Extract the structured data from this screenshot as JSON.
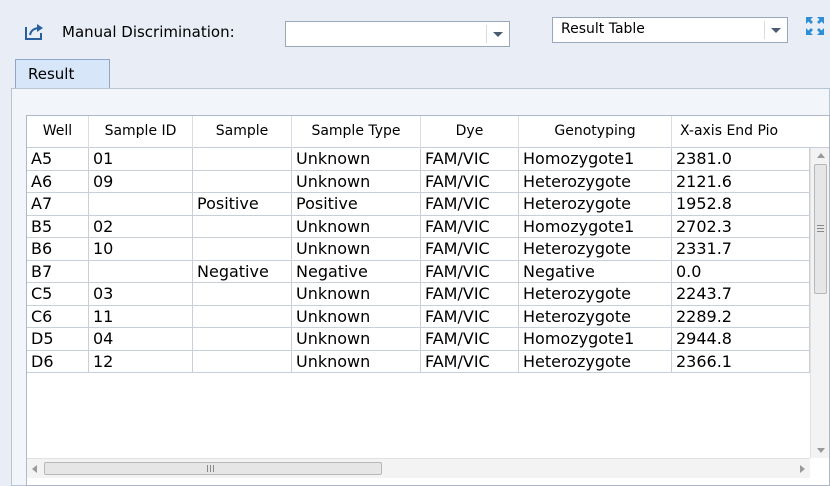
{
  "toolbar": {
    "manual_label": "Manual Discrimination:",
    "manual_value": "",
    "view_value": "Result Table"
  },
  "tabs": [
    {
      "label": "Result"
    }
  ],
  "table": {
    "columns": [
      "Well",
      "Sample ID",
      "Sample",
      "Sample Type",
      "Dye",
      "Genotyping",
      "X-axis End Pio"
    ],
    "rows": [
      [
        "A5",
        "01",
        "",
        "Unknown",
        "FAM/VIC",
        "Homozygote1",
        "2381.0"
      ],
      [
        "A6",
        "09",
        "",
        "Unknown",
        "FAM/VIC",
        "Heterozygote",
        "2121.6"
      ],
      [
        "A7",
        "",
        "Positive",
        "Positive",
        "FAM/VIC",
        "Heterozygote",
        "1952.8"
      ],
      [
        "B5",
        "02",
        "",
        "Unknown",
        "FAM/VIC",
        "Homozygote1",
        "2702.3"
      ],
      [
        "B6",
        "10",
        "",
        "Unknown",
        "FAM/VIC",
        "Heterozygote",
        "2331.7"
      ],
      [
        "B7",
        "",
        "Negative",
        "Negative",
        "FAM/VIC",
        "Negative",
        "0.0"
      ],
      [
        "C5",
        "03",
        "",
        "Unknown",
        "FAM/VIC",
        "Heterozygote",
        "2243.7"
      ],
      [
        "C6",
        "11",
        "",
        "Unknown",
        "FAM/VIC",
        "Heterozygote",
        "2289.2"
      ],
      [
        "D5",
        "04",
        "",
        "Unknown",
        "FAM/VIC",
        "Homozygote1",
        "2944.8"
      ],
      [
        "D6",
        "12",
        "",
        "Unknown",
        "FAM/VIC",
        "Heterozygote",
        "2366.1"
      ]
    ]
  },
  "icons": {
    "export": "export-icon",
    "expand": "expand-icon",
    "dropdown": "chevron-down-icon"
  },
  "colors": {
    "accent": "#2e8fd6",
    "tab_bg": "#d7e6f8"
  }
}
